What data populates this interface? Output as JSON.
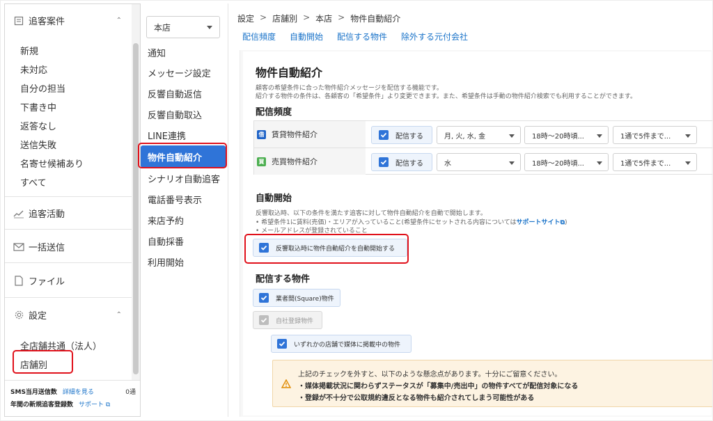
{
  "sidebar": {
    "header": {
      "label": "追客案件",
      "icon": "clipboard-icon"
    },
    "items": [
      "新規",
      "未対応",
      "自分の担当",
      "下書き中",
      "返答なし",
      "送信失敗",
      "名寄せ候補あり",
      "すべて"
    ],
    "sections": [
      {
        "label": "追客活動",
        "icon": "activity-icon"
      },
      {
        "label": "一括送信",
        "icon": "mail-icon"
      },
      {
        "label": "ファイル",
        "icon": "file-icon"
      },
      {
        "label": "設定",
        "icon": "gear-icon"
      }
    ],
    "settings_items": [
      "全店舗共通（法人）",
      "店舗別"
    ],
    "footer": {
      "sms_label": "SMS当月送信数",
      "sms_link": "詳細を見る",
      "sms_count": "0通",
      "annual_label": "年間の新規追客登録数",
      "annual_link": "サポート"
    }
  },
  "midnav": {
    "store": "本店",
    "items": [
      "通知",
      "メッセージ設定",
      "反響自動返信",
      "反響自動取込",
      "LINE連携",
      "物件自動紹介",
      "シナリオ自動追客",
      "電話番号表示",
      "来店予約",
      "自動採番",
      "利用開始"
    ],
    "active": "物件自動紹介"
  },
  "breadcrumb": [
    "設定",
    "店舗別",
    "本店",
    "物件自動紹介"
  ],
  "breadcrumb_sep": ">",
  "tabs": [
    "配信頻度",
    "自動開始",
    "配信する物件",
    "除外する元付会社"
  ],
  "page": {
    "title": "物件自動紹介",
    "desc1": "顧客の希望条件に合った物件紹介メッセージを配信する機能です。",
    "desc2": "紹介する物件の条件は、各顧客の「希望条件」より変更できます。また、希望条件は手動の物件紹介検索でも利用することができます。",
    "freq_heading": "配信頻度",
    "freq_rows": [
      {
        "badge": "借",
        "badge_color": "#1f63c7",
        "label": "賃貸物件紹介",
        "check": "配信する",
        "days": "月, 火, 水, 金",
        "time": "18時〜20時頃...",
        "count": "1通で5件まで..."
      },
      {
        "badge": "買",
        "badge_color": "#4caf50",
        "label": "売買物件紹介",
        "check": "配信する",
        "days": "水",
        "time": "18時〜20時頃...",
        "count": "1通で5件まで..."
      }
    ],
    "auto_heading": "自動開始",
    "auto_desc": "反響取込時、以下の条件を満たす追客に対して物件自動紹介を自動で開始します。",
    "auto_bullet1_pre": "•  希望条件1に賃料(売価)・エリアが入っていること(希望条件にセットされる内容については",
    "auto_bullet1_link": "サポートサイト",
    "auto_bullet1_post": ")",
    "auto_bullet2": "•  メールアドレスが登録されていること",
    "auto_check": "反響取込時に物件自動紹介を自動開始する",
    "deliver_heading": "配信する物件",
    "deliver_checks": {
      "square": "業者間(Square)物件",
      "own": "自社登録物件",
      "media": "いずれかの店舗で媒体に掲載中の物件"
    },
    "warning": {
      "line1": "上記のチェックを外すと、以下のような懸念点があります。十分にご留意ください。",
      "line2": "・媒体掲載状況に関わらずステータスが「募集中/売出中」の物件すべてが配信対象になる",
      "line3": "・登録が不十分で公取規約違反となる物件も紹介されてしまう可能性がある"
    }
  },
  "colors": {
    "accent": "#2f74d8",
    "highlight": "#e0101a",
    "link": "#1a73c9",
    "warning_bg": "#fdf3e2"
  }
}
